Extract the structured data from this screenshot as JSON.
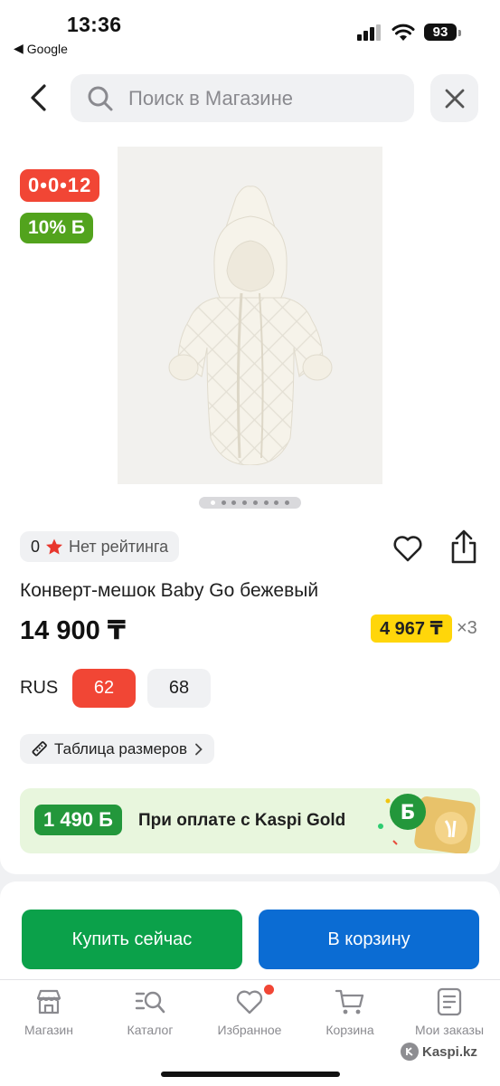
{
  "status_bar": {
    "time": "13:36",
    "back_app": "Google",
    "battery": "93"
  },
  "search": {
    "placeholder": "Поиск в Магазине"
  },
  "badges": {
    "timer": "0•0•12",
    "bonus": "10% Б"
  },
  "gallery": {
    "dot_count": 8,
    "active_index": 0
  },
  "rating": {
    "value": "0",
    "label": "Нет рейтинга"
  },
  "product": {
    "title": "Конверт-мешок Baby Go бежевый",
    "price": "14 900 ₸",
    "installment_price": "4 967 ₸",
    "installment_multiplier": "×3"
  },
  "sizes": {
    "label": "RUS",
    "options": [
      "62",
      "68"
    ],
    "selected": "62"
  },
  "size_table": {
    "label": "Таблица размеров"
  },
  "kaspi_gold": {
    "bonus": "1 490 Б",
    "text": "При оплате с Kaspi Gold"
  },
  "actions": {
    "buy_now": "Купить сейчас",
    "add_to_cart": "В корзину"
  },
  "nav": {
    "items": [
      {
        "label": "Магазин",
        "icon": "store-icon"
      },
      {
        "label": "Каталог",
        "icon": "catalog-search-icon"
      },
      {
        "label": "Избранное",
        "icon": "heart-icon"
      },
      {
        "label": "Корзина",
        "icon": "cart-icon"
      },
      {
        "label": "Мои заказы",
        "icon": "orders-icon"
      }
    ]
  },
  "watermark": "Kaspi.kz",
  "colors": {
    "accent_red": "#f14635",
    "bonus_green": "#52a31d",
    "buy_green": "#0ba14a",
    "cart_blue": "#0b6cd3",
    "installment_yellow": "#ffd60a"
  }
}
